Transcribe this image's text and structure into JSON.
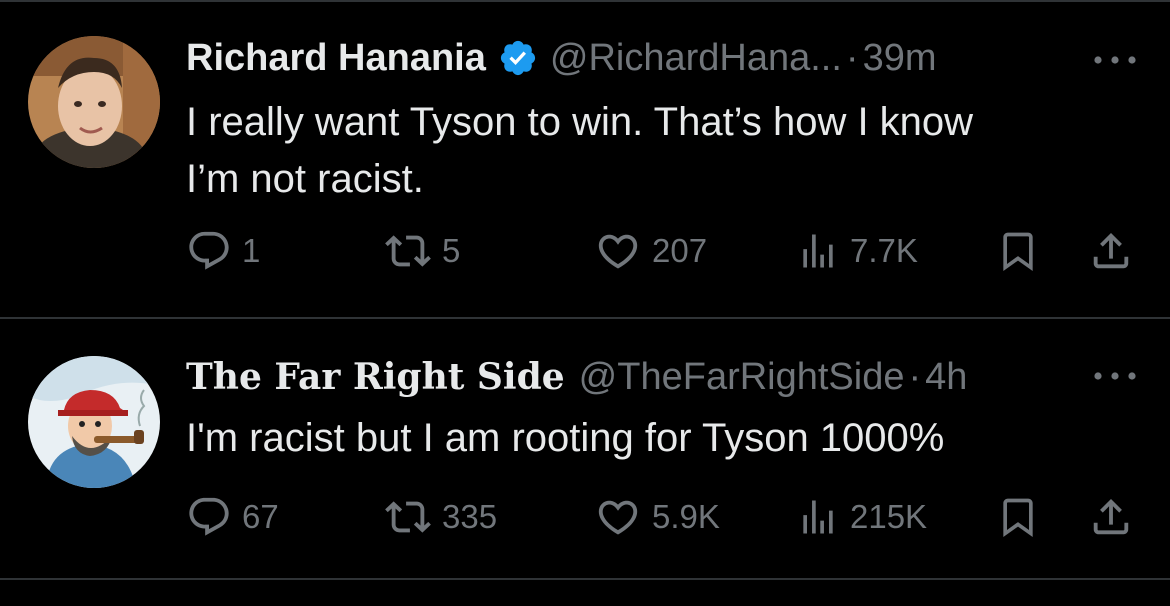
{
  "tweets": [
    {
      "name": "Richard Hanania",
      "handle": "@RichardHana...",
      "separator": "·",
      "time": "39m",
      "verified": true,
      "text_lines": [
        "I really want Tyson to win. That’s how I know",
        "I’m not racist."
      ],
      "replies": "1",
      "reposts": "5",
      "likes": "207",
      "views": "7.7K"
    },
    {
      "name": "The Far Right Side",
      "handle": "@TheFarRightSide",
      "separator": "·",
      "time": "4h",
      "verified": false,
      "text_lines": [
        "I'm racist but I am rooting for Tyson 1000%"
      ],
      "replies": "67",
      "reposts": "335",
      "likes": "5.9K",
      "views": "215K"
    }
  ],
  "colors": {
    "background": "#000000",
    "text": "#e7e9ea",
    "muted": "#71767b",
    "verified_blue": "#1d9bf0",
    "divider": "#2f3336"
  },
  "icons": [
    "reply-icon",
    "repost-icon",
    "like-icon",
    "views-icon",
    "bookmark-icon",
    "share-icon",
    "more-icon",
    "verified-badge-icon"
  ]
}
